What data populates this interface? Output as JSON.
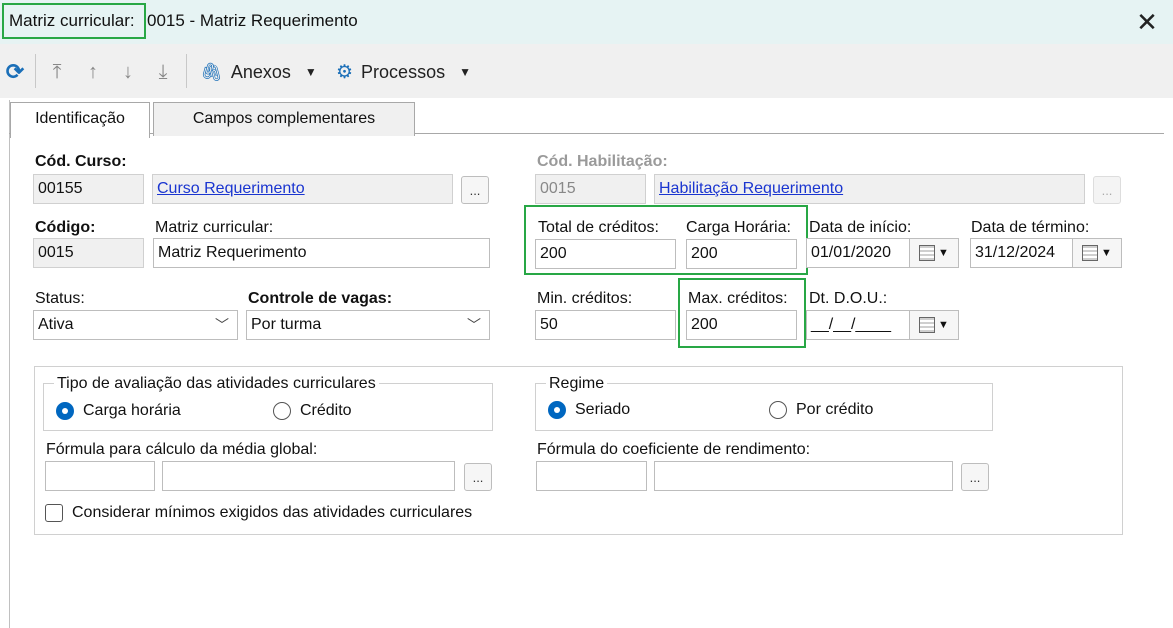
{
  "window": {
    "title_prefix": "Matriz curricular:",
    "title_rest": "0015 - Matriz Requerimento",
    "close_glyph": "✕"
  },
  "toolbar": {
    "refresh_glyph": "⟳",
    "first_glyph": "⤒",
    "up_glyph": "↑",
    "down_glyph": "↓",
    "last_glyph": "⤓",
    "attach_glyph": "🖇",
    "anexos_label": "Anexos",
    "gear_glyph": "⚙",
    "processos_label": "Processos",
    "caret_glyph": "▼"
  },
  "tabs": [
    {
      "label": "Identificação",
      "active": true
    },
    {
      "label": "Campos complementares",
      "active": false
    }
  ],
  "form": {
    "cod_curso": {
      "label": "Cód. Curso:",
      "value": "00155",
      "link": "Curso Requerimento",
      "dots": "..."
    },
    "cod_habilitacao": {
      "label": "Cód. Habilitação:",
      "value": "0015",
      "link": "Habilitação Requerimento",
      "dots": "..."
    },
    "codigo": {
      "label": "Código:",
      "value": "0015"
    },
    "matriz": {
      "label": "Matriz curricular:",
      "value": "Matriz Requerimento"
    },
    "total_creditos": {
      "label": "Total de créditos:",
      "value": "200"
    },
    "carga_horaria": {
      "label": "Carga Horária:",
      "value": "200"
    },
    "data_inicio": {
      "label": "Data de início:",
      "value": "01/01/2020"
    },
    "data_termino": {
      "label": "Data de término:",
      "value": "31/12/2024"
    },
    "status": {
      "label": "Status:",
      "value": "Ativa"
    },
    "controle_vagas": {
      "label": "Controle de vagas:",
      "value": "Por turma"
    },
    "min_creditos": {
      "label": "Min. créditos:",
      "value": "50"
    },
    "max_creditos": {
      "label": "Max. créditos:",
      "value": "200"
    },
    "dt_dou": {
      "label": "Dt. D.O.U.:",
      "value": "__/__/____"
    },
    "chevron_glyph": "﹀",
    "cal_caret_glyph": "▼"
  },
  "avaliacao": {
    "legend": "Tipo de avaliação das atividades curriculares",
    "options": [
      "Carga horária",
      "Crédito"
    ],
    "selected": "Carga horária"
  },
  "regime": {
    "legend": "Regime",
    "options": [
      "Seriado",
      "Por crédito"
    ],
    "selected": "Seriado"
  },
  "formula_media": {
    "label": "Fórmula para cálculo da média global:",
    "dots": "..."
  },
  "formula_coef": {
    "label": "Fórmula do coeficiente de rendimento:",
    "dots": "..."
  },
  "considerar": {
    "label": "Considerar mínimos exigidos das atividades curriculares",
    "checked": false
  },
  "colors": {
    "highlight": "#28a745",
    "link": "#1a35d0",
    "radio": "#0067c0",
    "titlebar": "#e6f3f3"
  }
}
